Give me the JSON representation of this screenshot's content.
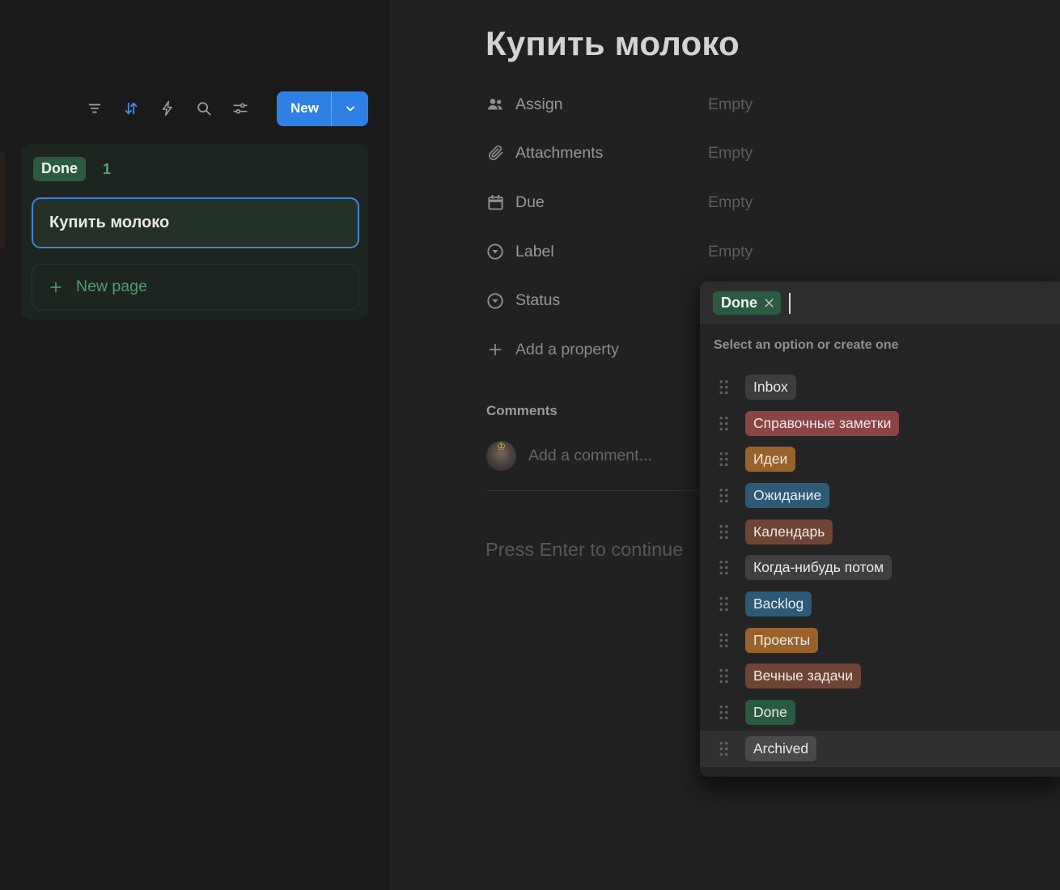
{
  "left_panel": {
    "toolbar": {
      "icons": [
        "filter-icon",
        "sort-icon",
        "lightning-icon",
        "search-icon",
        "sliders-icon"
      ],
      "new_button": {
        "label": "New"
      }
    },
    "group": {
      "status_label": "Done",
      "count": "1",
      "card_title": "Купить молоко",
      "new_page_label": "New page"
    }
  },
  "main": {
    "title": "Купить молоко",
    "properties": [
      {
        "icon": "assign-icon",
        "label": "Assign",
        "value": "Empty"
      },
      {
        "icon": "attachment-icon",
        "label": "Attachments",
        "value": "Empty"
      },
      {
        "icon": "calendar-icon",
        "label": "Due",
        "value": "Empty"
      },
      {
        "icon": "select-icon",
        "label": "Label",
        "value": "Empty"
      },
      {
        "icon": "select-icon",
        "label": "Status",
        "value": ""
      }
    ],
    "add_property_label": "Add a property",
    "comments": {
      "heading": "Comments",
      "placeholder": "Add a comment..."
    },
    "hint": "Press Enter to continue"
  },
  "status_dropdown": {
    "selected": {
      "label": "Done",
      "color": "#2b5a41"
    },
    "hint": "Select an option or create one",
    "options": [
      {
        "label": "Inbox",
        "color": "#3d3d3d",
        "hovered": false
      },
      {
        "label": "Справочные заметки",
        "color": "#8a4544",
        "hovered": false
      },
      {
        "label": "Идеи",
        "color": "#99622b",
        "hovered": false
      },
      {
        "label": "Ожидание",
        "color": "#2e5a78",
        "hovered": false
      },
      {
        "label": "Календарь",
        "color": "#6e4534",
        "hovered": false
      },
      {
        "label": "Когда-нибудь потом",
        "color": "#3f3f3f",
        "hovered": false
      },
      {
        "label": "Backlog",
        "color": "#2e5a78",
        "hovered": false
      },
      {
        "label": "Проекты",
        "color": "#99622b",
        "hovered": false
      },
      {
        "label": "Вечные задачи",
        "color": "#6e4534",
        "hovered": false
      },
      {
        "label": "Done",
        "color": "#2b5a41",
        "hovered": false
      },
      {
        "label": "Archived",
        "color": "#4a4a4a",
        "hovered": true
      }
    ]
  },
  "colors": {
    "accent_blue": "#2e80e4",
    "sort_active_blue": "#4589dd",
    "card_border_blue": "#4084d7",
    "green_accent": "#4d9e71",
    "tag_green": "#2b5a41"
  }
}
